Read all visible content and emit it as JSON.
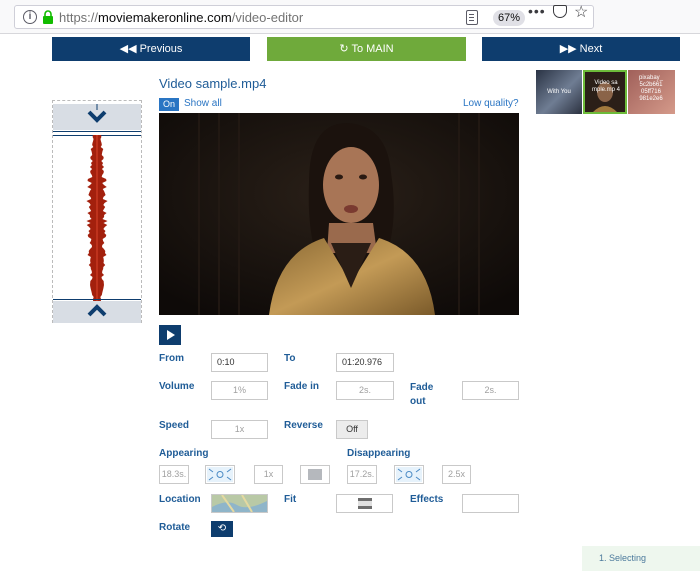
{
  "browser": {
    "url_prefix": "https://",
    "url_domain": "moviemakeronline.com",
    "url_path": "/video-editor",
    "zoom": "67%"
  },
  "nav": {
    "previous": "Previous",
    "main": "To MAIN",
    "next": "Next"
  },
  "thumbs": [
    {
      "label": "With You"
    },
    {
      "label": "Video sa mple.mp 4"
    },
    {
      "label": "pixabay_ 5c2b661 05ff716 981e2e6"
    }
  ],
  "video": {
    "title": "Video sample.mp4",
    "on_label": "On",
    "show_all": "Show all",
    "low_quality": "Low quality?"
  },
  "form": {
    "from_label": "From",
    "from_value": "0:10",
    "to_label": "To",
    "to_value": "01:20.976",
    "volume_label": "Volume",
    "volume_value": "1%",
    "fadein_label": "Fade in",
    "fadein_value": "2s.",
    "fadeout_label": "Fade out",
    "fadeout_value": "2s.",
    "speed_label": "Speed",
    "speed_value": "1x",
    "reverse_label": "Reverse",
    "reverse_value": "Off",
    "appearing_label": "Appearing",
    "appearing_time": "18.3s.",
    "appearing_speed": "1x",
    "disappearing_label": "Disappearing",
    "disappearing_time": "17.2s.",
    "disappearing_speed": "2.5x",
    "location_label": "Location",
    "fit_label": "Fit",
    "effects_label": "Effects",
    "rotate_label": "Rotate"
  },
  "status": {
    "text": "1. Selecting"
  },
  "colors": {
    "nav_blue": "#0e3d6e",
    "main_green": "#6faa3b",
    "label_blue": "#1f5c97",
    "waveform_red": "#a3200d"
  }
}
